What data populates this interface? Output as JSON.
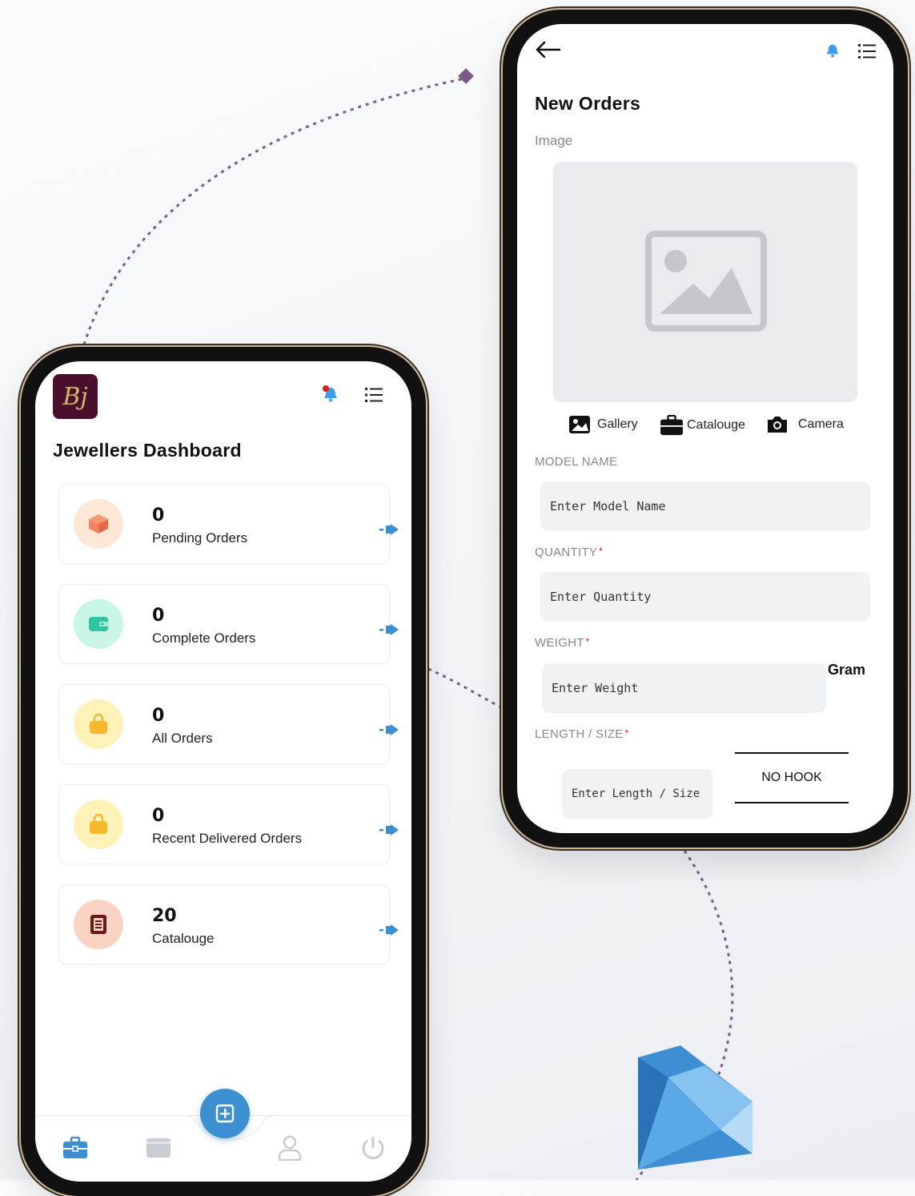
{
  "dashboard": {
    "logo_text": "Bj",
    "title": "Jewellers Dashboard",
    "cards": [
      {
        "count": "0",
        "label": "Pending Orders",
        "icon": "box-icon",
        "color": "#f4845f",
        "bg": "#fde8d8"
      },
      {
        "count": "0",
        "label": "Complete Orders",
        "icon": "wallet-icon",
        "color": "#2ec4a0",
        "bg": "#c8f5e8"
      },
      {
        "count": "0",
        "label": "All Orders",
        "icon": "shopping-bag-icon",
        "color": "#f5b82e",
        "bg": "#fff2b8"
      },
      {
        "count": "0",
        "label": "Recent Delivered Orders",
        "icon": "shopping-bag-icon",
        "color": "#f5b82e",
        "bg": "#fff2b8"
      },
      {
        "count": "20",
        "label": "Catalouge",
        "icon": "catalogue-icon",
        "color": "#c0392b",
        "bg": "#fbd3c4"
      }
    ],
    "nav": [
      "briefcase-icon",
      "wallet-icon",
      "add-icon",
      "user-icon",
      "power-icon"
    ]
  },
  "new_order": {
    "title": "New Orders",
    "image_label": "Image",
    "sources": {
      "gallery": "Gallery",
      "catalogue": "Catalouge",
      "camera": "Camera"
    },
    "model_name": {
      "label": "MODEL NAME",
      "placeholder": "Enter Model Name"
    },
    "quantity": {
      "label": "QUANTITY",
      "required": "*",
      "placeholder": "Enter Quantity"
    },
    "weight": {
      "label": "WEIGHT",
      "required": "*",
      "placeholder": "Enter Weight",
      "unit": "Gram"
    },
    "length": {
      "label": "LENGTH / SIZE",
      "required": "*",
      "placeholder": "Enter Length / Size",
      "hook": "NO HOOK"
    }
  },
  "colors": {
    "accent": "#3c8fd1",
    "logo_bg": "#4a0f2d",
    "logo_text": "#d9b26b",
    "required": "#e11111"
  }
}
